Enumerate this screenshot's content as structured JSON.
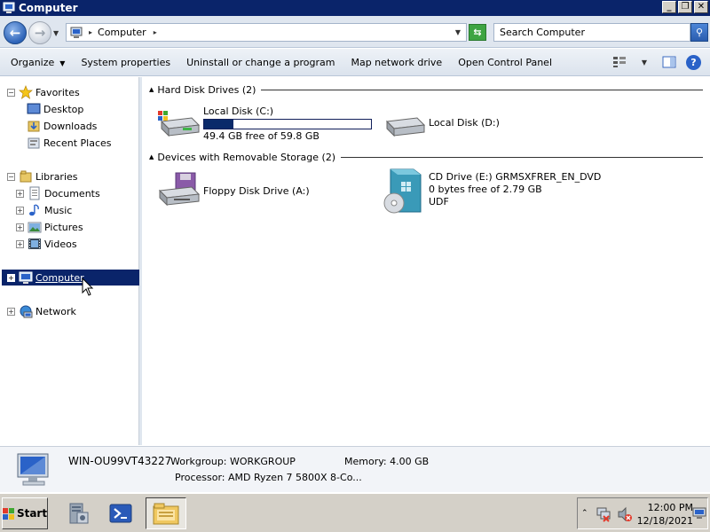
{
  "window": {
    "title": "Computer"
  },
  "address": {
    "path": "Computer",
    "search_placeholder": "Search Computer"
  },
  "toolbar": {
    "organize": "Organize",
    "system_properties": "System properties",
    "uninstall": "Uninstall or change a program",
    "map_drive": "Map network drive",
    "control_panel": "Open Control Panel"
  },
  "nav": {
    "favorites": "Favorites",
    "desktop": "Desktop",
    "downloads": "Downloads",
    "recent": "Recent Places",
    "libraries": "Libraries",
    "documents": "Documents",
    "music": "Music",
    "pictures": "Pictures",
    "videos": "Videos",
    "computer": "Computer",
    "network": "Network"
  },
  "groups": {
    "hdd_title": "Hard Disk Drives (2)",
    "removable_title": "Devices with Removable Storage (2)"
  },
  "drives": {
    "c": {
      "name": "Local Disk (C:)",
      "free": "49.4 GB free of 59.8 GB",
      "used_fraction": 0.174
    },
    "d": {
      "name": "Local Disk (D:)"
    },
    "a": {
      "name": "Floppy Disk Drive (A:)"
    },
    "e": {
      "name": "CD Drive (E:) GRMSXFRER_EN_DVD",
      "free": "0 bytes free of 2.79 GB",
      "fs": "UDF"
    }
  },
  "details": {
    "computer_name": "WIN-OU99VT43227",
    "workgroup": "Workgroup: WORKGROUP",
    "memory": "Memory: 4.00 GB",
    "processor": "Processor: AMD Ryzen 7 5800X 8-Co..."
  },
  "taskbar": {
    "start": "Start",
    "time": "12:00 PM",
    "date": "12/18/2021"
  },
  "colors": {
    "titlebar": "#0a246a",
    "selection": "#0a246a",
    "capacity_fill": "#0a2a6a"
  }
}
